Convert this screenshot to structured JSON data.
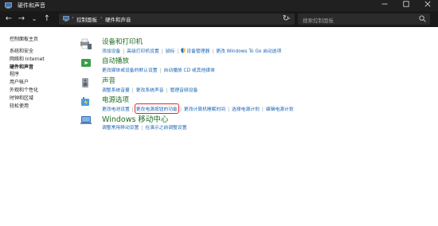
{
  "titlebar": {
    "title": "硬件和声音",
    "minimize_icon": "minimize-icon",
    "maximize_icon": "maximize-icon",
    "close_icon": "close-icon"
  },
  "navbar": {
    "back": "←",
    "forward": "→",
    "recent": "⌄",
    "up": "↑",
    "breadcrumbs": [
      "控制面板",
      "硬件和声音"
    ],
    "refresh": "↻",
    "search_placeholder": "搜索控制面板"
  },
  "sidebar": {
    "home": "控制面板主页",
    "items": [
      {
        "label": "系统和安全",
        "active": false
      },
      {
        "label": "网络和 Internet",
        "active": false
      },
      {
        "label": "硬件和声音",
        "active": true
      },
      {
        "label": "程序",
        "active": false
      },
      {
        "label": "用户帐户",
        "active": false
      },
      {
        "label": "外观和个性化",
        "active": false
      },
      {
        "label": "时钟和区域",
        "active": false
      },
      {
        "label": "轻松使用",
        "active": false
      }
    ]
  },
  "categories": [
    {
      "title": "设备和打印机",
      "icon": "printer-icon",
      "links": [
        "添加设备",
        "高级打印机设置",
        "鼠标",
        "设备管理器",
        "更改 Windows To Go 启动选项"
      ],
      "shield_on": [
        3
      ]
    },
    {
      "title": "自动播放",
      "icon": "autoplay-icon",
      "links": [
        "更改媒体或设备的默认设置",
        "自动播放 CD 或其他媒体"
      ],
      "shield_on": []
    },
    {
      "title": "声音",
      "icon": "speaker-icon",
      "links": [
        "调整系统音量",
        "更改系统声音",
        "管理音频设备"
      ],
      "shield_on": []
    },
    {
      "title": "电源选项",
      "icon": "battery-icon",
      "links": [
        "更改电池设置",
        "更改电源按钮的功能",
        "更改计算机睡眠时间",
        "选择电源计划",
        "编辑电源计划"
      ],
      "shield_on": [],
      "highlight": 1
    },
    {
      "title": "Windows 移动中心",
      "icon": "mobility-center-icon",
      "links": [
        "调整常用移动设置",
        "在演示之前调整设置"
      ],
      "shield_on": []
    }
  ],
  "colors": {
    "category_title": "#1f6b25",
    "link": "#1964b4",
    "highlight_box": "#e2282c",
    "titlebar_bg": "#202020"
  }
}
